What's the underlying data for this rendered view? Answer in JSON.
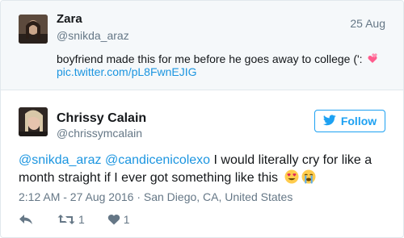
{
  "quoted": {
    "name": "Zara",
    "handle": "@snikda_araz",
    "date": "25 Aug",
    "text": "boyfriend made this for me before he goes away to college (':",
    "link": "pic.twitter.com/pL8FwnEJIG",
    "emoji_icon": "two-hearts-icon"
  },
  "tweet": {
    "name": "Chrissy Calain",
    "handle": "@chrissymcalain",
    "follow_label": "Follow",
    "mention_1": "@snikda_araz",
    "mention_2": "@candicenicolexo",
    "text_line_1": " I would literally cry for like a",
    "text_line_2": "month straight if I ever got something like this",
    "emojis": [
      "heart-eyes-icon",
      "crying-face-icon"
    ],
    "meta": "2:12 AM - 27 Aug 2016 · San Diego, CA, United States",
    "retweet_count": "1",
    "like_count": "1"
  },
  "colors": {
    "accent": "#1da1f2",
    "link": "#1b95e0",
    "muted": "#657786",
    "border": "#e1e8ed",
    "quoted_bg": "#f5f8fa"
  }
}
